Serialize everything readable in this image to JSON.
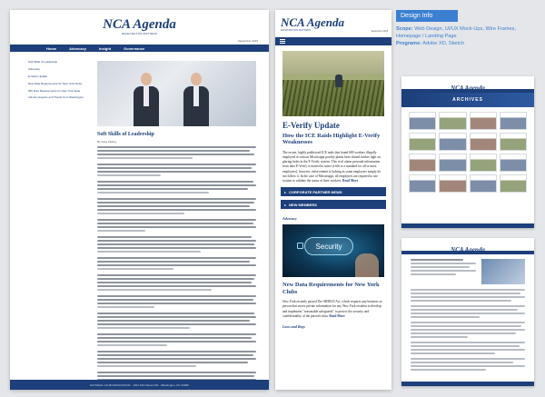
{
  "desktop": {
    "logo_mark": "NCA Agenda",
    "logo_sub": "WASHINGTON MATTERS",
    "date": "September 2019",
    "nav": [
      "Home",
      "Advocacy",
      "Insight",
      "Governance"
    ],
    "sidebar": [
      "Soft Skills of Leadership",
      "Advocacy",
      "E-Verify Update",
      "New Data Requirements for New York Clubs",
      "IRS Rule Requirements for New York State",
      "Industry Experts and Trends from Washington"
    ],
    "article_title": "Soft Skills of Leadership",
    "byline": "By Greg Kipling",
    "footer": "NATIONAL CLUB ASSOCIATION · 1201 15th Street NW · Washington, DC 20005"
  },
  "mobile": {
    "logo_mark": "NCA Agenda",
    "logo_sub": "WASHINGTON MATTERS",
    "date": "September 2019",
    "headline": "E-Verify Update",
    "subhead": "How the ICE Raids Highlight E-Verify Weaknesses",
    "paragraph": "The recent, highly publicized ICE raids that found 680 workers illegally employed at various Mississippi poultry plants have shined further light on glaring holes in the E-Verify system. This civil alarm personal information from data E-Verify is marred in some (a 6th to a standard for all or most employers), however, enforcement is lacking as some employers simply do not follow it. In the case of Mississippi, all employers are required to use system to validate the status of their workers.",
    "read_more": "Read More",
    "accordion": [
      "CORPORATE PARTNER NEWS",
      "NEW MEMBERS"
    ],
    "section_kicker": "Advocacy",
    "security_label": "Security",
    "story_title": "New Data Requirements for New York Clubs",
    "story_text": "New York recently passed The SHIELD Act, which requires any business or person that stores private information for any New York resident to develop and implement \"reasonable safeguards\" to protect the security and confidentiality of the person's data.",
    "story_read_more": "Read More",
    "next_kicker": "Laws and Regs"
  },
  "info": {
    "tag": "Design Info",
    "scope_label": "Scope:",
    "scope": "Web Design, UI/UX Mock-Ups, Wire Frames, Homepage / Landing Page",
    "programs_label": "Programs:",
    "programs": "Adobe XD, Sketch"
  },
  "thumbs": {
    "logo_mark": "NCA Agenda",
    "archive_label": "ARCHIVES"
  },
  "colors": {
    "navy": "#1d3f7a",
    "accent": "#3b7fd1",
    "bg": "#e4e6e9"
  }
}
